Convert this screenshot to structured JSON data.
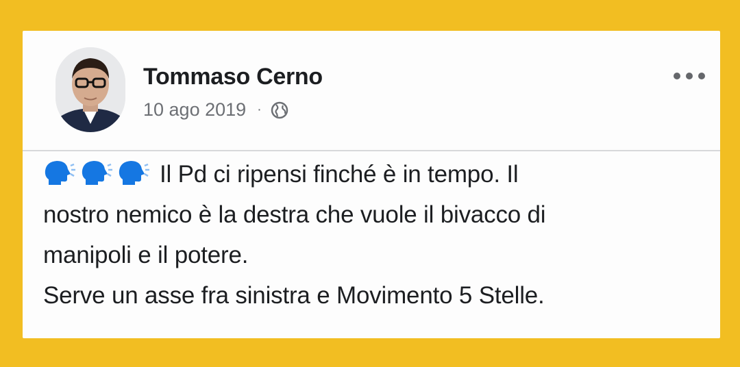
{
  "post": {
    "author": "Tommaso Cerno",
    "date": "10 ago 2019",
    "separator": "·",
    "privacy_icon": "globe-icon",
    "options_icon": "more-options-icon",
    "reaction_icons": [
      "speaking-head-icon",
      "speaking-head-icon",
      "speaking-head-icon"
    ],
    "body_line1": "Il Pd ci ripensi finché è in tempo. Il",
    "body_line2": "nostro nemico è la destra che vuole il bivacco di",
    "body_line3": "manipoli e il potere.",
    "body_line4": "Serve un asse fra sinistra e Movimento 5 Stelle."
  },
  "colors": {
    "frame": "#f2be22",
    "card": "#fdfdfd",
    "text": "#1c1e21",
    "meta": "#6c6f74",
    "speaking_head": "#1577e2"
  }
}
